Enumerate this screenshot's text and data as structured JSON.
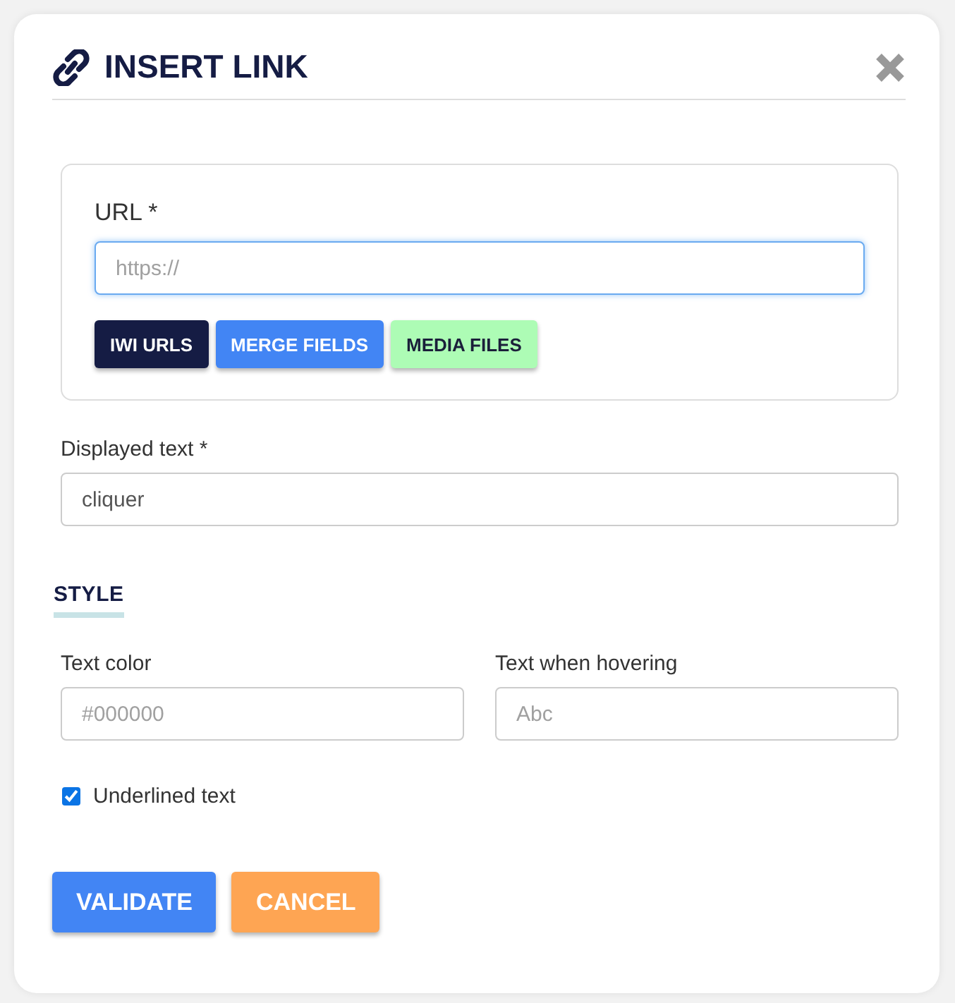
{
  "dialog": {
    "title": "INSERT LINK"
  },
  "url_section": {
    "label": "URL *",
    "placeholder": "https://",
    "focused": true,
    "buttons": [
      {
        "label": "IWI URLS",
        "color": "#151c44"
      },
      {
        "label": "MERGE FIELDS",
        "color": "#4285f4"
      },
      {
        "label": "MEDIA FILES",
        "color": "#adfcb5"
      }
    ]
  },
  "displayed_text": {
    "label": "Displayed text *",
    "value": "cliquer"
  },
  "style_section": {
    "heading": "STYLE",
    "fields": [
      {
        "label": "Text color",
        "placeholder": "#000000"
      },
      {
        "label": "Text when hovering",
        "placeholder": "Abc"
      }
    ],
    "underlined": {
      "label": "Underlined text",
      "checked": true
    }
  },
  "actions": [
    {
      "label": "VALIDATE",
      "color": "#4285f4"
    },
    {
      "label": "CANCEL",
      "color": "#fea553"
    }
  ]
}
